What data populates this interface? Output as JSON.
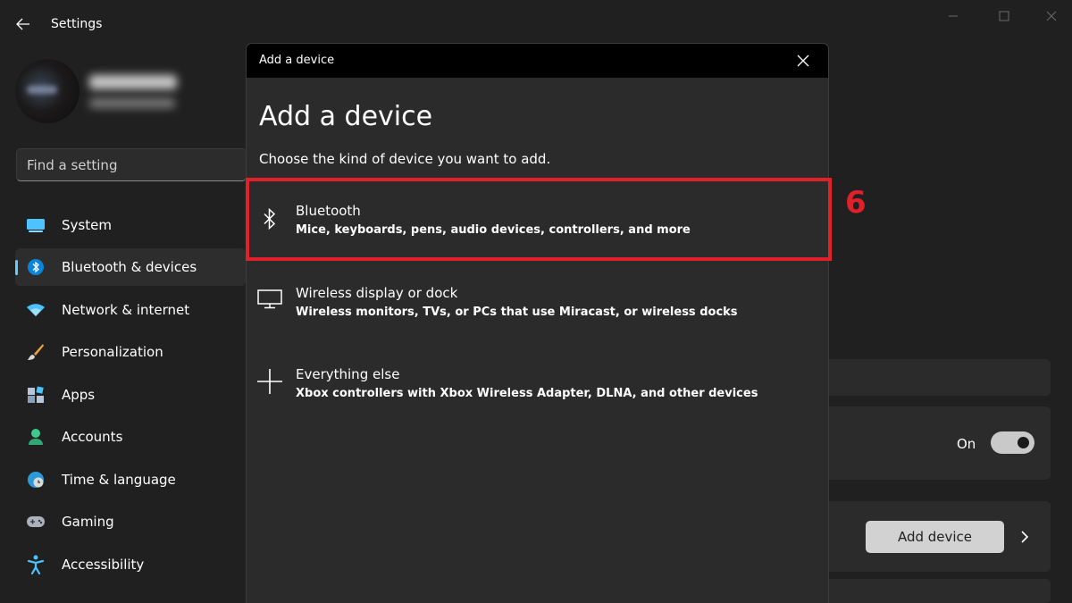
{
  "app": {
    "title": "Settings"
  },
  "search": {
    "placeholder": "Find a setting"
  },
  "sidebar": {
    "items": [
      {
        "label": "System",
        "icon": "monitor-icon"
      },
      {
        "label": "Bluetooth & devices",
        "icon": "bluetooth-icon",
        "active": true
      },
      {
        "label": "Network & internet",
        "icon": "wifi-icon"
      },
      {
        "label": "Personalization",
        "icon": "brush-icon"
      },
      {
        "label": "Apps",
        "icon": "apps-icon"
      },
      {
        "label": "Accounts",
        "icon": "person-icon"
      },
      {
        "label": "Time & language",
        "icon": "globe-clock-icon"
      },
      {
        "label": "Gaming",
        "icon": "gamepad-icon"
      },
      {
        "label": "Accessibility",
        "icon": "accessibility-icon"
      }
    ]
  },
  "content": {
    "toggle_label": "On",
    "toggle_state": true,
    "add_device_label": "Add device"
  },
  "dialog": {
    "window_title": "Add a device",
    "heading": "Add a device",
    "subtitle": "Choose the kind of device you want to add.",
    "options": [
      {
        "title": "Bluetooth",
        "description": "Mice, keyboards, pens, audio devices, controllers, and more",
        "icon": "bluetooth-icon"
      },
      {
        "title": "Wireless display or dock",
        "description": "Wireless monitors, TVs, or PCs that use Miracast, or wireless docks",
        "icon": "monitor-icon"
      },
      {
        "title": "Everything else",
        "description": "Xbox controllers with Xbox Wireless Adapter, DLNA, and other devices",
        "icon": "plus-icon"
      }
    ]
  },
  "annotation": {
    "step": "6"
  },
  "colors": {
    "accent": "#60cdff",
    "highlight": "#e0202a",
    "background": "#202020",
    "dialog_bg": "#2b2b2b"
  }
}
